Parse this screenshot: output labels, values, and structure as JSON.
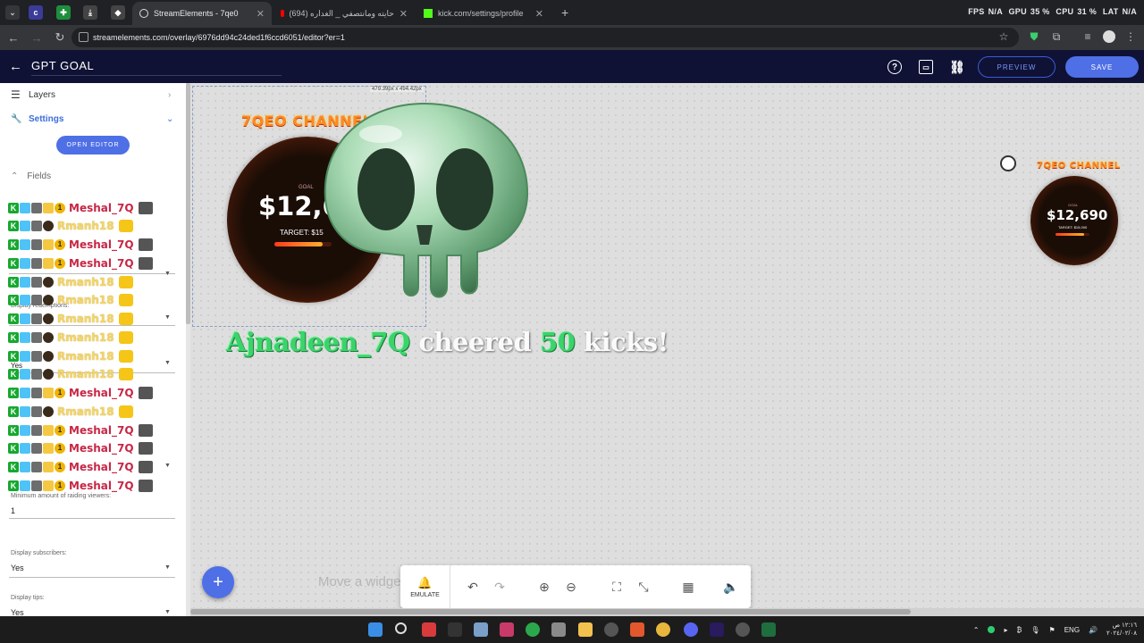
{
  "browser": {
    "tabs": [
      {
        "label": "StreamElements - 7qe0",
        "active": true
      },
      {
        "label": "حايته ومانتصفي _ الغداره (694)",
        "active": false
      },
      {
        "label": "kick.com/settings/profile",
        "active": false
      }
    ],
    "new_tab": "+",
    "url": "streamelements.com/overlay/6976dd94c24ded1f6ccd6051/editor?er=1",
    "stats": {
      "fps_label": "FPS",
      "fps": "N/A",
      "gpu_label": "GPU",
      "gpu": "35 %",
      "cpu_label": "CPU",
      "cpu": "31 %",
      "lat_label": "LAT",
      "lat": "N/A"
    }
  },
  "header": {
    "title": "GPT GOAL",
    "preview": "PREVIEW",
    "save": "SAVE"
  },
  "sidebar": {
    "layers": "Layers",
    "settings": "Settings",
    "open_editor": "OPEN EDITOR",
    "fields": "Fields",
    "raid_label": "Minimum amount of raiding viewers:",
    "raid_value": "1",
    "subs_label": "Display subscribers:",
    "subs_value": "Yes",
    "tips_label": "Display tips:",
    "tips_value": "Yes",
    "faded_labels": {
      "redemptions": "Display redemptions:",
      "yes": "Yes"
    }
  },
  "chat": [
    {
      "name": "Meshal_7Q",
      "style": "red"
    },
    {
      "name": "Rmanh18",
      "style": "yel"
    },
    {
      "name": "Meshal_7Q",
      "style": "red"
    },
    {
      "name": "Meshal_7Q",
      "style": "red"
    },
    {
      "name": "Rmanh18",
      "style": "yel"
    },
    {
      "name": "Rmanh18",
      "style": "yel"
    },
    {
      "name": "Rmanh18",
      "style": "yel"
    },
    {
      "name": "Rmanh18",
      "style": "yel"
    },
    {
      "name": "Rmanh18",
      "style": "yel"
    },
    {
      "name": "Rmanh18",
      "style": "yel"
    },
    {
      "name": "Meshal_7Q",
      "style": "red"
    },
    {
      "name": "Rmanh18",
      "style": "yel"
    },
    {
      "name": "Meshal_7Q",
      "style": "red"
    },
    {
      "name": "Meshal_7Q",
      "style": "red"
    },
    {
      "name": "Meshal_7Q",
      "style": "red"
    },
    {
      "name": "Meshal_7Q",
      "style": "red"
    }
  ],
  "canvas": {
    "dimensions": "479.39px x 494.42px",
    "goal_large": {
      "channel": "7QEO CHANNEL",
      "amount": "$12,6",
      "goal": "GOAL",
      "target": "TARGET: $15"
    },
    "goal_small": {
      "channel": "7QEO CHANNEL",
      "amount": "$12,690",
      "goal": "GOAL",
      "target": "TARGET: $15,000"
    },
    "alert": {
      "user": "Ajnadeen_7Q",
      "verb": "cheered",
      "amount": "50",
      "unit": "kicks!"
    },
    "move_hint": "Move a widge",
    "emulate": "EMULATE",
    "add": "+"
  },
  "taskbar": {
    "lang": "ENG",
    "time": "١٢:١٦ ص",
    "date": "٢٠٢٤/٠٢/٠٨"
  },
  "colors": {
    "accent": "#4f6fe6",
    "header_bg": "#0f1234",
    "alert_green": "#3bd46b",
    "chat_red": "#c72746"
  }
}
